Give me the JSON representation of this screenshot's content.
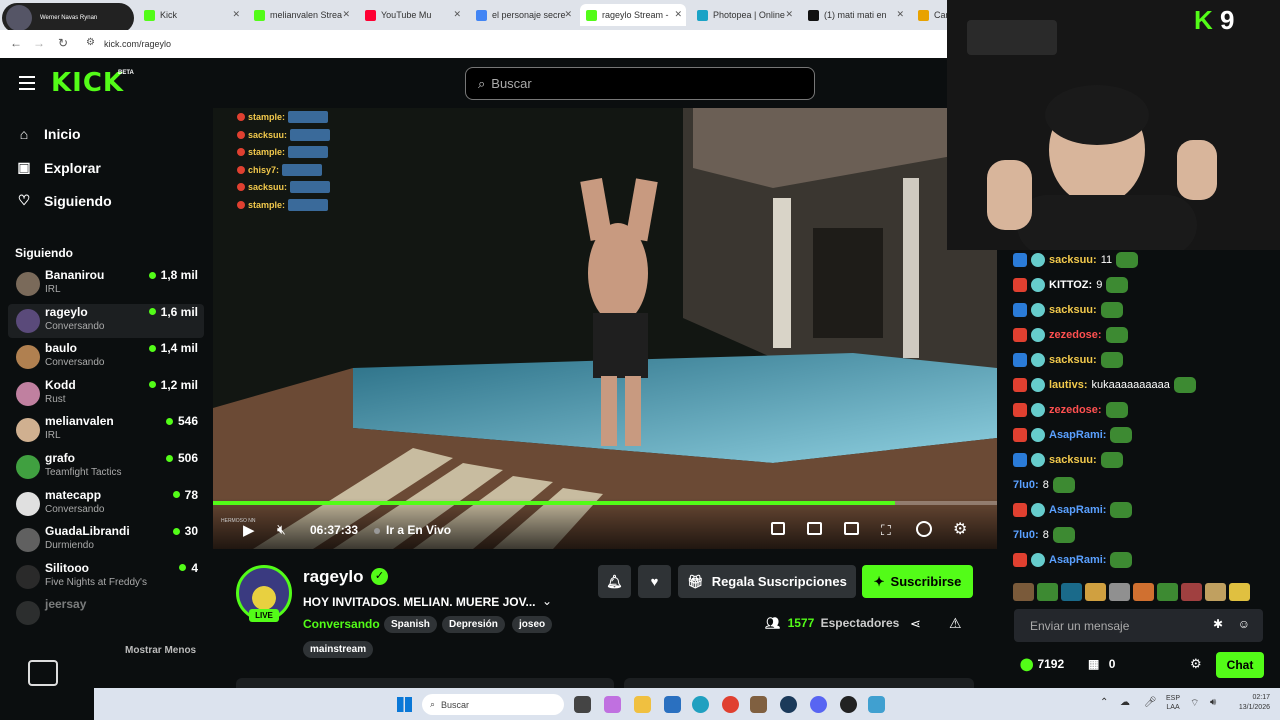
{
  "browser": {
    "tabs": [
      {
        "label": "Kick",
        "color": "#53fc18"
      },
      {
        "label": "melianvalen Strea",
        "color": "#53fc18"
      },
      {
        "label": "YouTube Mu",
        "color": "#ff0033"
      },
      {
        "label": "el personaje secre",
        "color": "#4285f4"
      },
      {
        "label": "rageylo Stream - ",
        "color": "#53fc18"
      },
      {
        "label": "Photopea | Online",
        "color": "#1aa3c6"
      },
      {
        "label": "(1) mati mati en",
        "color": "#111111"
      },
      {
        "label": "Car",
        "color": "#e8a200"
      }
    ],
    "profile_label": "Werner Navas Rynan",
    "url": "kick.com/rageylo"
  },
  "header": {
    "logo": "KICK",
    "beta": "BETA",
    "search_placeholder": "Buscar"
  },
  "sidebar": {
    "nav": [
      {
        "label": "Inicio",
        "icon": "home-icon"
      },
      {
        "label": "Explorar",
        "icon": "compass-icon"
      },
      {
        "label": "Siguiendo",
        "icon": "heart-icon"
      }
    ],
    "following_title": "Siguiendo",
    "channels": [
      {
        "name": "Bananirou",
        "category": "IRL",
        "viewers": "1,8 mil",
        "color": "#7a6a5a"
      },
      {
        "name": "rageylo",
        "category": "Conversando",
        "viewers": "1,6 mil",
        "color": "#5a4a7a"
      },
      {
        "name": "baulo",
        "category": "Conversando",
        "viewers": "1,4 mil",
        "color": "#b08050"
      },
      {
        "name": "Kodd",
        "category": "Rust",
        "viewers": "1,2 mil",
        "color": "#c080a0"
      },
      {
        "name": "melianvalen",
        "category": "IRL",
        "viewers": "546",
        "color": "#d0b090"
      },
      {
        "name": "grafo",
        "category": "Teamfight Tactics",
        "viewers": "506",
        "color": "#40a040"
      },
      {
        "name": "matecapp",
        "category": "Conversando",
        "viewers": "78",
        "color": "#e0e0e0"
      },
      {
        "name": "GuadaLibrandi",
        "category": "Durmiendo",
        "viewers": "30",
        "color": "#606060"
      },
      {
        "name": "Silitooo",
        "category": "Five Nights at Freddy's",
        "viewers": "4",
        "color": "#2a2a2a"
      },
      {
        "name": "jeersay",
        "category": "",
        "viewers": "",
        "color": "#555555"
      }
    ],
    "show_less": "Mostrar Menos"
  },
  "overlay_chat": [
    {
      "user": "stample:"
    },
    {
      "user": "sacksuu:"
    },
    {
      "user": "stample:"
    },
    {
      "user": "chisy7:"
    },
    {
      "user": "sacksuu:"
    },
    {
      "user": "stample:"
    }
  ],
  "player": {
    "time": "06:37:33",
    "go_live": "Ir a En Vivo",
    "progress": 0.87,
    "bottom_note": "HERMOSO NN"
  },
  "stream": {
    "channel": "rageylo",
    "live_badge": "LIVE",
    "title": "HOY INVITADOS. MELIAN. MUERE JOV...",
    "category": "Conversando",
    "tags": [
      "Spanish",
      "Depresión",
      "joseo",
      "mainstream"
    ],
    "viewers": "1577",
    "viewers_label": "Espectadores",
    "gift_label": "Regala Suscripciones",
    "subscribe_label": "Suscribirse"
  },
  "chat": {
    "messages": [
      {
        "user": "sacksuu:",
        "text": "11",
        "color": "#f2c94c"
      },
      {
        "user": "KITTOZ:",
        "text": "9",
        "color": "#ffffff"
      },
      {
        "user": "sacksuu:",
        "text": "",
        "color": "#f2c94c"
      },
      {
        "user": "zezedose:",
        "text": "",
        "color": "#ff5050"
      },
      {
        "user": "sacksuu:",
        "text": "",
        "color": "#f2c94c"
      },
      {
        "user": "lautivs:",
        "text": "kukaaaaaaaaaa",
        "color": "#f2c94c"
      },
      {
        "user": "zezedose:",
        "text": "",
        "color": "#ff5050"
      },
      {
        "user": "AsapRami:",
        "text": "",
        "color": "#5aa0ff"
      },
      {
        "user": "sacksuu:",
        "text": "",
        "color": "#f2c94c"
      },
      {
        "user": "7lu0:",
        "text": "8",
        "color": "#5aa0ff"
      },
      {
        "user": "AsapRami:",
        "text": "",
        "color": "#5aa0ff"
      },
      {
        "user": "7lu0:",
        "text": "8",
        "color": "#5aa0ff"
      },
      {
        "user": "AsapRami:",
        "text": "",
        "color": "#5aa0ff"
      }
    ],
    "input_placeholder": "Enviar un mensaje",
    "points": "7192",
    "gifts": "0",
    "chat_button": "Chat"
  },
  "webcam": {
    "counter": "9"
  },
  "taskbar": {
    "search": "Buscar",
    "lang": "ESP",
    "lang2": "LAA",
    "time": "02:17",
    "date": "13/1/2026"
  }
}
